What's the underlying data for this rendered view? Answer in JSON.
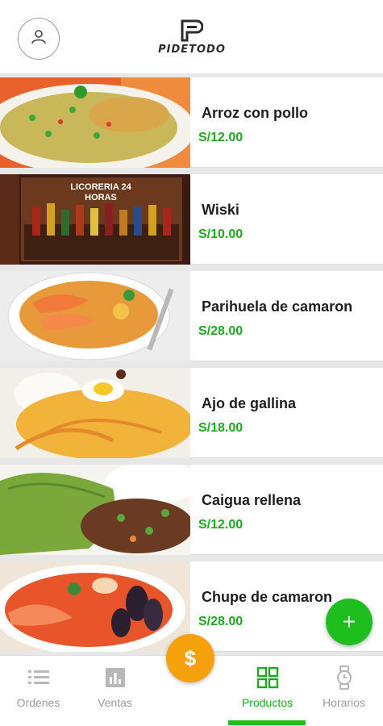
{
  "header": {
    "logo_text": "PIDETODO",
    "avatar_icon": "user-icon"
  },
  "products": [
    {
      "name": "Arroz con pollo",
      "price": "S/12.00"
    },
    {
      "name": "Wiski",
      "price": "S/10.00",
      "image_text": "LICORERIA 24 HORAS"
    },
    {
      "name": "Parihuela de camaron",
      "price": "S/28.00"
    },
    {
      "name": "Ajo de gallina",
      "price": "S/18.00"
    },
    {
      "name": "Caigua rellena",
      "price": "S/12.00"
    },
    {
      "name": "Chupe de camaron",
      "price": "S/28.00"
    }
  ],
  "add_button": "+",
  "center_button": "$",
  "tabs": [
    {
      "label": "Ordenes",
      "icon": "list-icon"
    },
    {
      "label": "Ventas",
      "icon": "bar-chart-icon"
    },
    {
      "label": "Productos",
      "icon": "grid-icon"
    },
    {
      "label": "Horarios",
      "icon": "watch-icon"
    }
  ],
  "colors": {
    "accent_green": "#1fbe1f",
    "price_green": "#1fa81f",
    "center_orange": "#f5a20a"
  }
}
